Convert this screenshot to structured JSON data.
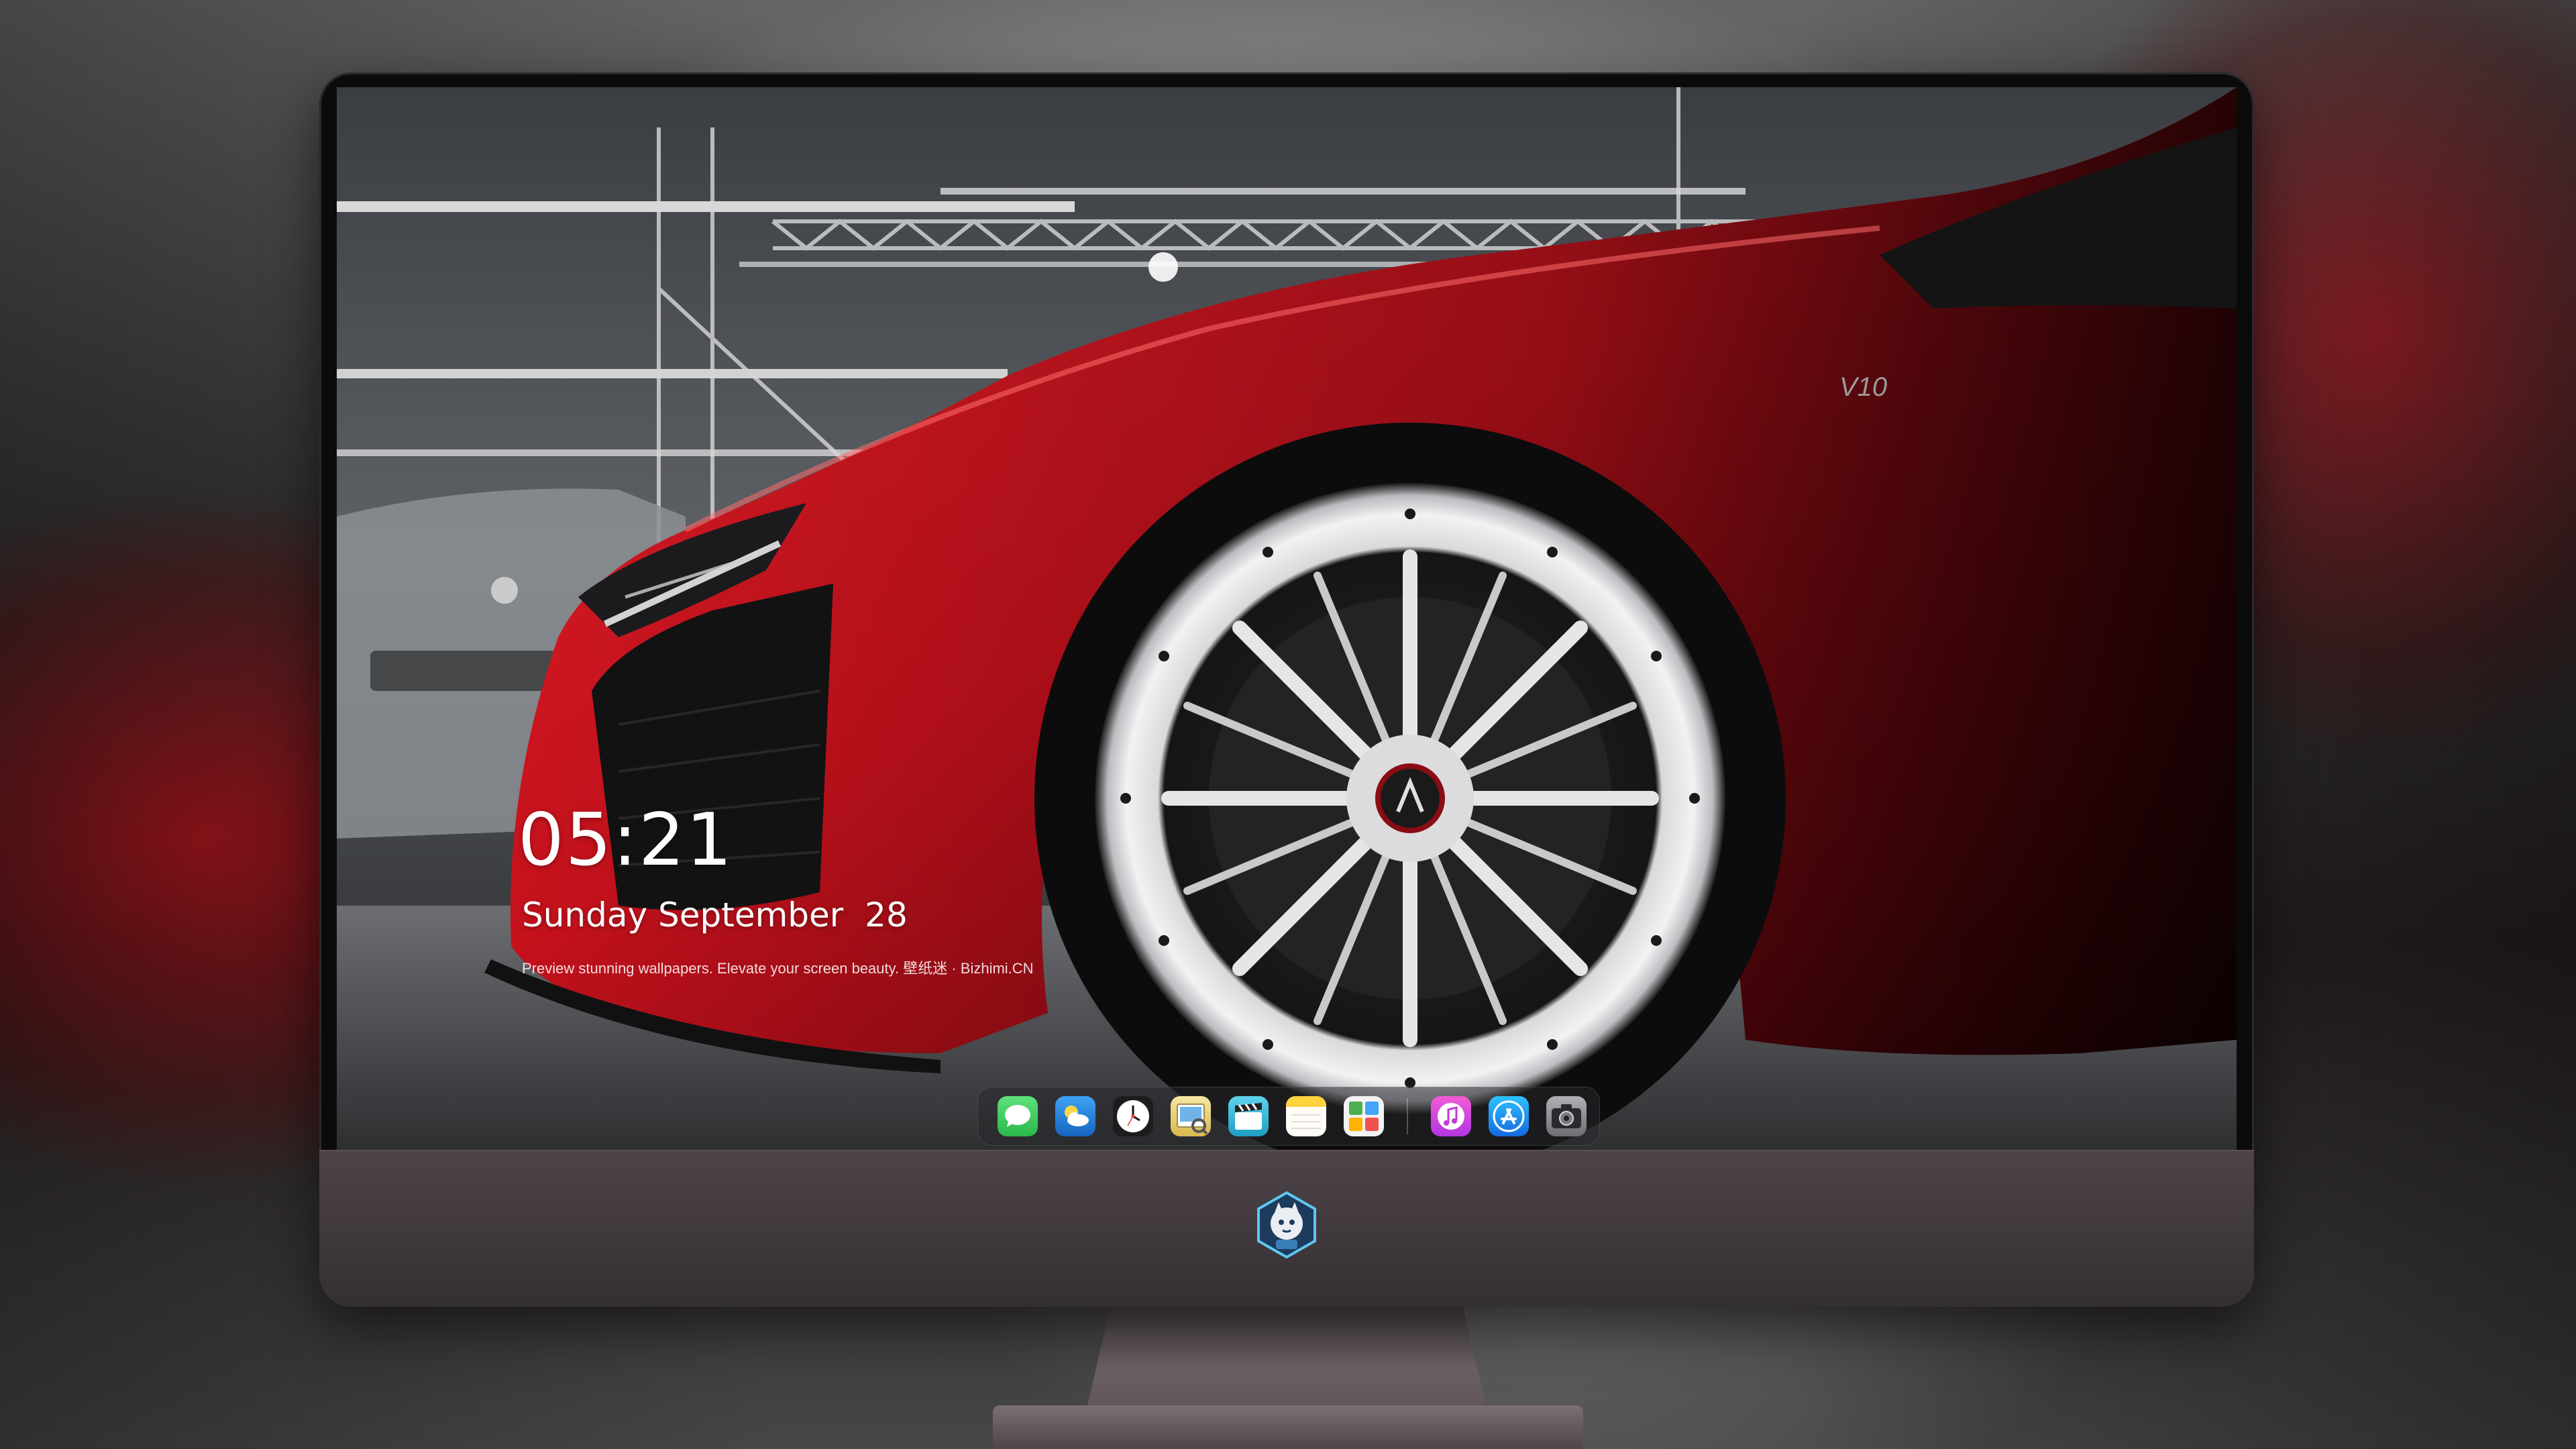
{
  "lock_screen": {
    "time": "05:21",
    "date": "Sunday September  28",
    "tagline": "Preview stunning wallpapers. Elevate your screen beauty. 壁纸迷 · Bizhimi.CN"
  },
  "wallpaper": {
    "car_badge": "V10",
    "accent_color": "#c8101c"
  },
  "dock": {
    "apps": [
      {
        "name": "messages-icon",
        "color": "#34c759"
      },
      {
        "name": "weather-icon",
        "color": "#1e88e5"
      },
      {
        "name": "clock-icon",
        "color": "#ffffff"
      },
      {
        "name": "preview-icon",
        "color": "#e8d27a"
      },
      {
        "name": "clips-icon",
        "color": "#2bb6d6"
      },
      {
        "name": "notes-icon",
        "color": "#ffd64a"
      },
      {
        "name": "photos-grid-icon",
        "color": "#4cae50"
      },
      {
        "name": "music-icon",
        "color": "#e24bd1"
      },
      {
        "name": "app-store-icon",
        "color": "#1f8cf0"
      },
      {
        "name": "camera-icon",
        "color": "#8e8e93"
      }
    ]
  }
}
